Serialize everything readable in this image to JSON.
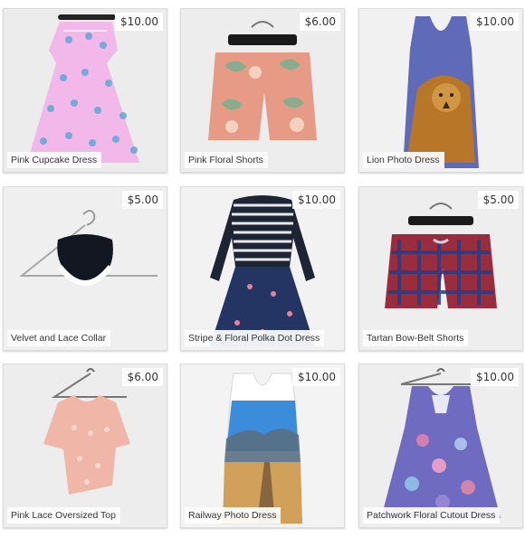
{
  "products": [
    {
      "title": "Pink Cupcake Dress",
      "price": "$10.00",
      "icon": "pink-dress-icon",
      "color": "#f0b7e6"
    },
    {
      "title": "Pink Floral Shorts",
      "price": "$6.00",
      "icon": "floral-shorts-icon",
      "color": "#e79a86"
    },
    {
      "title": "Lion Photo Dress",
      "price": "$10.00",
      "icon": "lion-dress-icon",
      "color": "#5f6bb8"
    },
    {
      "title": "Velvet and Lace Collar",
      "price": "$5.00",
      "icon": "collar-icon",
      "color": "#1b1f28"
    },
    {
      "title": "Stripe & Floral Polka Dot Dress",
      "price": "$10.00",
      "icon": "stripe-dress-icon",
      "color": "#253563"
    },
    {
      "title": "Tartan Bow-Belt Shorts",
      "price": "$5.00",
      "icon": "tartan-shorts-icon",
      "color": "#9a2d3d"
    },
    {
      "title": "Pink Lace Oversized Top",
      "price": "$6.00",
      "icon": "lace-top-icon",
      "color": "#f0b6a7"
    },
    {
      "title": "Railway Photo Dress",
      "price": "$10.00",
      "icon": "railway-dress-icon",
      "color": "#3b8ddb"
    },
    {
      "title": "Patchwork Floral Cutout Dress",
      "price": "$10.00",
      "icon": "patchwork-dress-icon",
      "color": "#6e6bc1"
    }
  ]
}
